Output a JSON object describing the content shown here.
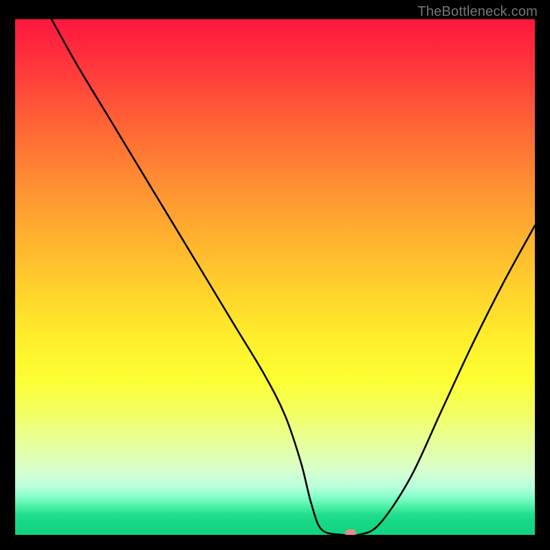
{
  "watermark": "TheBottleneck.com",
  "chart_data": {
    "type": "line",
    "title": "",
    "xlabel": "",
    "ylabel": "",
    "x_range": [
      0,
      100
    ],
    "y_range": [
      0,
      100
    ],
    "grid": false,
    "legend": false,
    "note": "Bottleneck-style curve. Y is bottleneck percentage (0 at bottom / green = no bottleneck, 100 at top / red = severe). X is a relative hardware-balance axis. Values are read off the plotted curve relative to the gradient axis; no numeric axes are printed in the image.",
    "series": [
      {
        "name": "bottleneck-curve",
        "x": [
          7,
          12,
          18,
          24,
          30,
          36,
          42,
          48,
          52,
          55,
          57,
          59,
          63,
          66,
          70,
          76,
          82,
          88,
          94,
          100
        ],
        "y": [
          100,
          91,
          81,
          71,
          61,
          51,
          41,
          31,
          23,
          14,
          6,
          1,
          0,
          0,
          2,
          11,
          24,
          37,
          49,
          60
        ]
      }
    ],
    "optimal_marker": {
      "x": 64.5,
      "y": 0
    },
    "gradient_stops": [
      {
        "pct": 0,
        "color": "#ff163f"
      },
      {
        "pct": 50,
        "color": "#ffd62c"
      },
      {
        "pct": 90,
        "color": "#baffdb"
      },
      {
        "pct": 100,
        "color": "#10d380"
      }
    ]
  }
}
